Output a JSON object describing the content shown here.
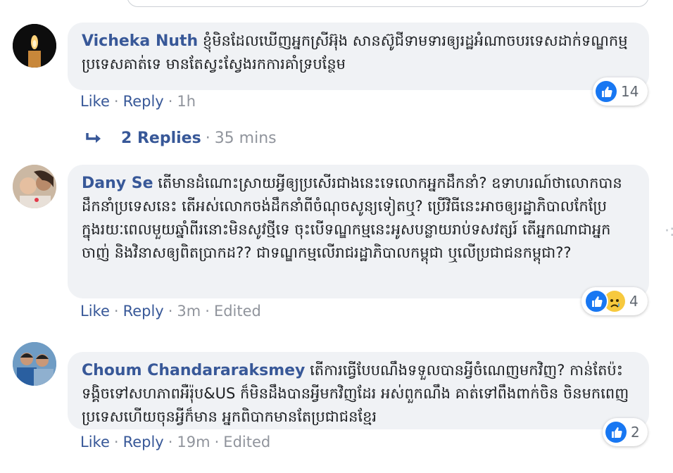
{
  "comments": [
    {
      "author": "Vicheka Nuth",
      "text": "ខ្ញុំមិនដែលឃើញអ្នកស្រីអ៊ុង សាន​ស៊ូជី​ទាមទារឲ្យរដ្ឋអំណាចបរទេសដាក់ទណ្ឌកម្មប្រទេសគាត់ទេ មានតែស្វះស្វែងរកការគាំទ្របន្ថែម",
      "like_label": "Like",
      "reply_label": "Reply",
      "time": "1h",
      "edited": "",
      "reaction_count": "14"
    },
    {
      "author": "Dany Se",
      "text": "តើមានដំណោះស្រាយអ្វីឲ្យប្រសើរជាងនេះទេលោកអ្នកដឹកនាំ? ឧទាហរណ៍ថាលោកបានដឹកនាំប្រទេសនេះ តើអស់លោកចង់ដឹកនាំពីចំណុចសូន្យទៀតឬ? ប្រើវិធីនេះអាចឲ្យរដ្ឋាភិបាលកែប្រែក្នុងរយៈពេលមួយឆ្នាំពីរនោះមិនសូវថ្មីទេ ចុះបើទណ្ឌកម្មនេះអូសបន្លាយរាប់ទសវត្សរ៍ តើអ្នកណាជាអ្នកចាញ់ និងវិនាសឲ្យពិតប្រាកដ?? ជាទណ្ឌកម្មលើរាជរដ្ឋាភិបាលកម្ពុជា ឬលើប្រជាជនកម្ពុជា??",
      "like_label": "Like",
      "reply_label": "Reply",
      "time": "3m",
      "edited": "Edited",
      "reaction_count": "4"
    },
    {
      "author": "Choum Chandararaksmey",
      "text": "តើការធ្វើបែបណឹងទទួលបានអ្វីចំណេញមកវិញ? កាន់តែប៉ះទង្គិចទៅសហភាពអឺរ៉ុប&US ក៏មិនដឹងបានអ្វីមកវិញដែរ អស់ពួកណឹង គាត់ទៅពឹងពាក់ចិន ចិនមកពេញប្រទេសហើយចុនអ្វីក៏មាន អ្នកពិបាកមានតែប្រជាជនខ្មែរ",
      "like_label": "Like",
      "reply_label": "Reply",
      "time": "19m",
      "edited": "Edited",
      "reaction_count": "2"
    }
  ],
  "replies": {
    "label": "2 Replies",
    "time": "35 mins"
  },
  "colors": {
    "link": "#385898",
    "bubble": "#f0f2f5",
    "meta": "#90949c",
    "like_blue": "#1877f2"
  },
  "icons": [
    "candle-avatar-icon",
    "thumbs-up-icon",
    "sad-face-icon",
    "reply-arrow-icon"
  ]
}
